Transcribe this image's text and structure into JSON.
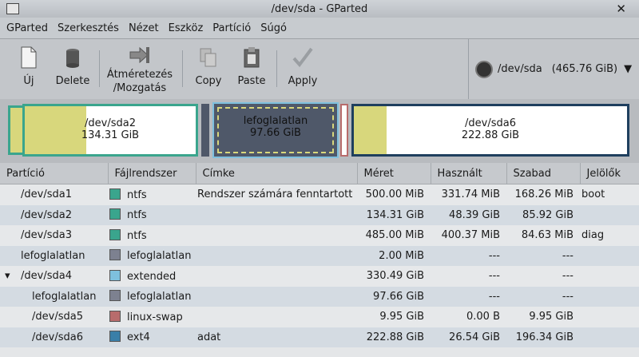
{
  "window": {
    "title": "/dev/sda - GParted"
  },
  "menu": [
    "GParted",
    "Szerkesztés",
    "Nézet",
    "Eszköz",
    "Partíció",
    "Súgó"
  ],
  "toolbar": {
    "new": "Új",
    "delete": "Delete",
    "resize_line1": "Átméretezés",
    "resize_line2": "/Mozgatás",
    "copy": "Copy",
    "paste": "Paste",
    "apply": "Apply"
  },
  "device": {
    "label": "/dev/sda",
    "size": "(465.76 GiB)"
  },
  "disk_map": [
    {
      "name": "/dev/sda2",
      "size": "134.31 GiB",
      "used_fraction": 0.36
    },
    {
      "name": "lefoglalatlan",
      "size": "97.66 GiB"
    },
    {
      "name": "/dev/sda6",
      "size": "222.88 GiB",
      "used_fraction": 0.12
    }
  ],
  "table": {
    "headers": [
      "Partíció",
      "Fájlrendszer",
      "Címke",
      "Méret",
      "Használt",
      "Szabad",
      "Jelölők"
    ],
    "rows": [
      {
        "partition": "/dev/sda1",
        "fs": "ntfs",
        "fs_color": "#3aa58d",
        "label": "Rendszer számára fenntartott",
        "size": "500.00 MiB",
        "used": "331.74 MiB",
        "free": "168.26 MiB",
        "flags": "boot",
        "indent": 0
      },
      {
        "partition": "/dev/sda2",
        "fs": "ntfs",
        "fs_color": "#3aa58d",
        "label": "",
        "size": "134.31 GiB",
        "used": "48.39 GiB",
        "free": "85.92 GiB",
        "flags": "",
        "indent": 0
      },
      {
        "partition": "/dev/sda3",
        "fs": "ntfs",
        "fs_color": "#3aa58d",
        "label": "",
        "size": "485.00 MiB",
        "used": "400.37 MiB",
        "free": "84.63 MiB",
        "flags": "diag",
        "indent": 0
      },
      {
        "partition": "lefoglalatlan",
        "fs": "lefoglalatlan",
        "fs_color": "#7d8190",
        "label": "",
        "size": "2.00 MiB",
        "used": "---",
        "free": "---",
        "flags": "",
        "indent": 0
      },
      {
        "partition": "/dev/sda4",
        "fs": "extended",
        "fs_color": "#7ec0de",
        "label": "",
        "size": "330.49 GiB",
        "used": "---",
        "free": "---",
        "flags": "",
        "indent": 0,
        "expander": "▾"
      },
      {
        "partition": "lefoglalatlan",
        "fs": "lefoglalatlan",
        "fs_color": "#7d8190",
        "label": "",
        "size": "97.66 GiB",
        "used": "---",
        "free": "---",
        "flags": "",
        "indent": 1
      },
      {
        "partition": "/dev/sda5",
        "fs": "linux-swap",
        "fs_color": "#b86c6c",
        "label": "",
        "size": "9.95 GiB",
        "used": "0.00 B",
        "free": "9.95 GiB",
        "flags": "",
        "indent": 1
      },
      {
        "partition": "/dev/sda6",
        "fs": "ext4",
        "fs_color": "#3a7fa8",
        "label": "adat",
        "size": "222.88 GiB",
        "used": "26.54 GiB",
        "free": "196.34 GiB",
        "flags": "",
        "indent": 1
      }
    ]
  },
  "colors": {
    "used": "#d8d77c",
    "free": "#ffffff",
    "ntfs_border": "#3aa58d",
    "ext4_border": "#1f3f5e",
    "unallocated": "#4f5869",
    "extended_border": "#7ec0de"
  }
}
